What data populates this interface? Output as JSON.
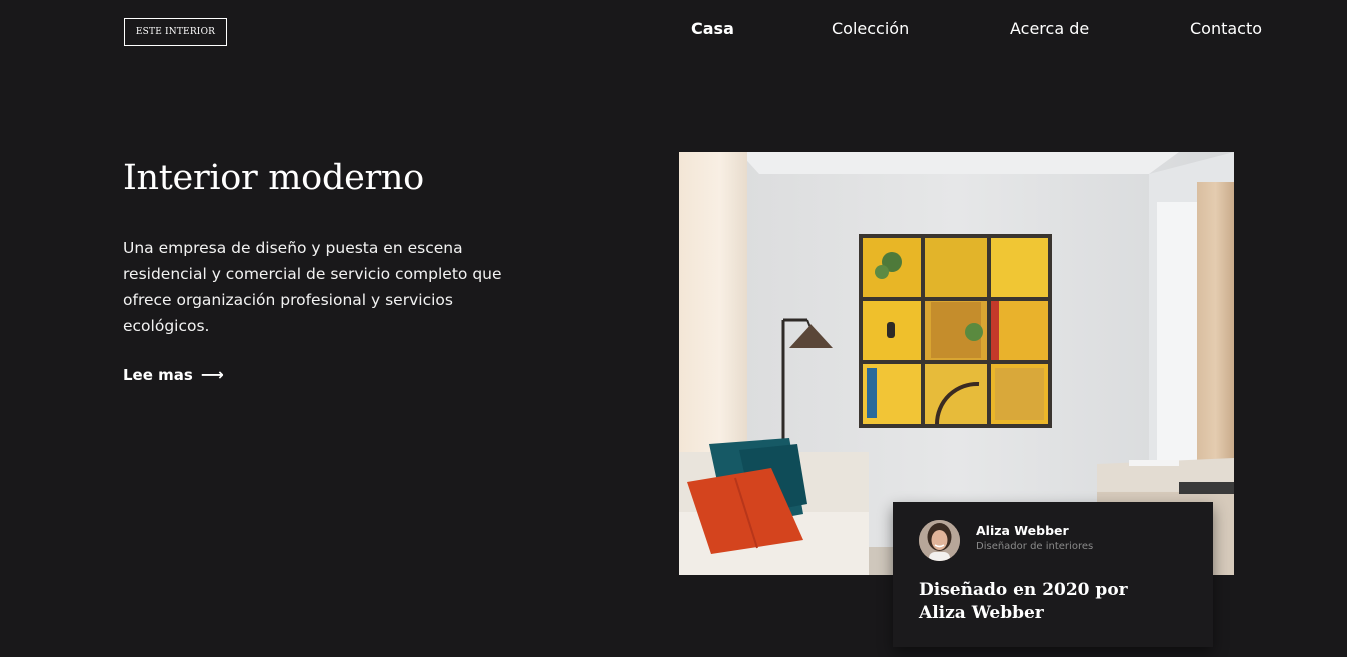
{
  "header": {
    "logo": "ESTE INTERIOR",
    "nav": [
      {
        "label": "Casa",
        "active": true
      },
      {
        "label": "Colección",
        "active": false
      },
      {
        "label": "Acerca de",
        "active": false
      },
      {
        "label": "Contacto",
        "active": false
      }
    ]
  },
  "hero": {
    "title": "Interior moderno",
    "description": "Una empresa de diseño y puesta en escena residencial y comercial de servicio completo que ofrece organización profesional y servicios ecológicos.",
    "cta_label": "Lee mas",
    "cta_icon": "arrow-right-icon"
  },
  "card": {
    "designer_name": "Aliza Webber",
    "designer_role": "Diseñador de interiores",
    "title": "Diseñado en 2020 por Aliza Webber"
  },
  "colors": {
    "background": "#19181a",
    "text": "#ffffff",
    "muted": "#8a8a8a"
  }
}
